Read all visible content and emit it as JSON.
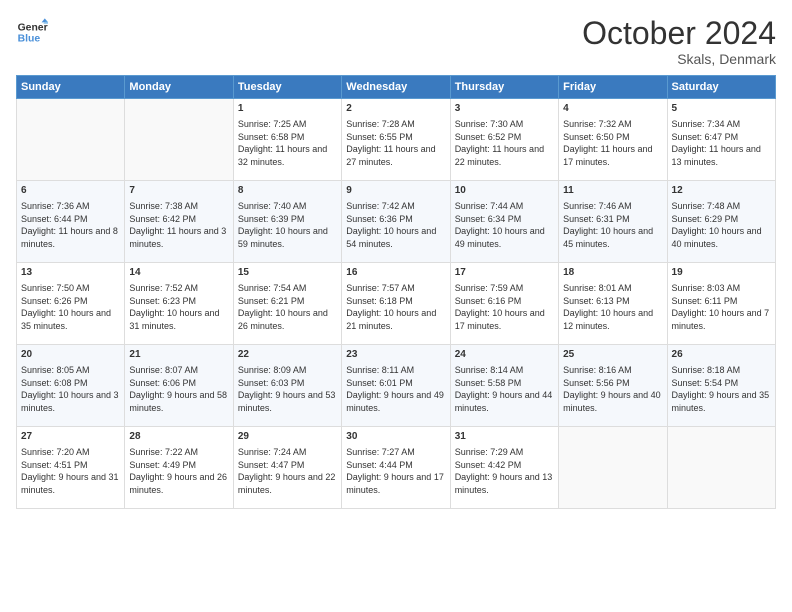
{
  "logo": {
    "line1": "General",
    "line2": "Blue"
  },
  "header": {
    "title": "October 2024",
    "subtitle": "Skals, Denmark"
  },
  "weekdays": [
    "Sunday",
    "Monday",
    "Tuesday",
    "Wednesday",
    "Thursday",
    "Friday",
    "Saturday"
  ],
  "weeks": [
    [
      {
        "day": "",
        "sunrise": "",
        "sunset": "",
        "daylight": ""
      },
      {
        "day": "",
        "sunrise": "",
        "sunset": "",
        "daylight": ""
      },
      {
        "day": "1",
        "sunrise": "Sunrise: 7:25 AM",
        "sunset": "Sunset: 6:58 PM",
        "daylight": "Daylight: 11 hours and 32 minutes."
      },
      {
        "day": "2",
        "sunrise": "Sunrise: 7:28 AM",
        "sunset": "Sunset: 6:55 PM",
        "daylight": "Daylight: 11 hours and 27 minutes."
      },
      {
        "day": "3",
        "sunrise": "Sunrise: 7:30 AM",
        "sunset": "Sunset: 6:52 PM",
        "daylight": "Daylight: 11 hours and 22 minutes."
      },
      {
        "day": "4",
        "sunrise": "Sunrise: 7:32 AM",
        "sunset": "Sunset: 6:50 PM",
        "daylight": "Daylight: 11 hours and 17 minutes."
      },
      {
        "day": "5",
        "sunrise": "Sunrise: 7:34 AM",
        "sunset": "Sunset: 6:47 PM",
        "daylight": "Daylight: 11 hours and 13 minutes."
      }
    ],
    [
      {
        "day": "6",
        "sunrise": "Sunrise: 7:36 AM",
        "sunset": "Sunset: 6:44 PM",
        "daylight": "Daylight: 11 hours and 8 minutes."
      },
      {
        "day": "7",
        "sunrise": "Sunrise: 7:38 AM",
        "sunset": "Sunset: 6:42 PM",
        "daylight": "Daylight: 11 hours and 3 minutes."
      },
      {
        "day": "8",
        "sunrise": "Sunrise: 7:40 AM",
        "sunset": "Sunset: 6:39 PM",
        "daylight": "Daylight: 10 hours and 59 minutes."
      },
      {
        "day": "9",
        "sunrise": "Sunrise: 7:42 AM",
        "sunset": "Sunset: 6:36 PM",
        "daylight": "Daylight: 10 hours and 54 minutes."
      },
      {
        "day": "10",
        "sunrise": "Sunrise: 7:44 AM",
        "sunset": "Sunset: 6:34 PM",
        "daylight": "Daylight: 10 hours and 49 minutes."
      },
      {
        "day": "11",
        "sunrise": "Sunrise: 7:46 AM",
        "sunset": "Sunset: 6:31 PM",
        "daylight": "Daylight: 10 hours and 45 minutes."
      },
      {
        "day": "12",
        "sunrise": "Sunrise: 7:48 AM",
        "sunset": "Sunset: 6:29 PM",
        "daylight": "Daylight: 10 hours and 40 minutes."
      }
    ],
    [
      {
        "day": "13",
        "sunrise": "Sunrise: 7:50 AM",
        "sunset": "Sunset: 6:26 PM",
        "daylight": "Daylight: 10 hours and 35 minutes."
      },
      {
        "day": "14",
        "sunrise": "Sunrise: 7:52 AM",
        "sunset": "Sunset: 6:23 PM",
        "daylight": "Daylight: 10 hours and 31 minutes."
      },
      {
        "day": "15",
        "sunrise": "Sunrise: 7:54 AM",
        "sunset": "Sunset: 6:21 PM",
        "daylight": "Daylight: 10 hours and 26 minutes."
      },
      {
        "day": "16",
        "sunrise": "Sunrise: 7:57 AM",
        "sunset": "Sunset: 6:18 PM",
        "daylight": "Daylight: 10 hours and 21 minutes."
      },
      {
        "day": "17",
        "sunrise": "Sunrise: 7:59 AM",
        "sunset": "Sunset: 6:16 PM",
        "daylight": "Daylight: 10 hours and 17 minutes."
      },
      {
        "day": "18",
        "sunrise": "Sunrise: 8:01 AM",
        "sunset": "Sunset: 6:13 PM",
        "daylight": "Daylight: 10 hours and 12 minutes."
      },
      {
        "day": "19",
        "sunrise": "Sunrise: 8:03 AM",
        "sunset": "Sunset: 6:11 PM",
        "daylight": "Daylight: 10 hours and 7 minutes."
      }
    ],
    [
      {
        "day": "20",
        "sunrise": "Sunrise: 8:05 AM",
        "sunset": "Sunset: 6:08 PM",
        "daylight": "Daylight: 10 hours and 3 minutes."
      },
      {
        "day": "21",
        "sunrise": "Sunrise: 8:07 AM",
        "sunset": "Sunset: 6:06 PM",
        "daylight": "Daylight: 9 hours and 58 minutes."
      },
      {
        "day": "22",
        "sunrise": "Sunrise: 8:09 AM",
        "sunset": "Sunset: 6:03 PM",
        "daylight": "Daylight: 9 hours and 53 minutes."
      },
      {
        "day": "23",
        "sunrise": "Sunrise: 8:11 AM",
        "sunset": "Sunset: 6:01 PM",
        "daylight": "Daylight: 9 hours and 49 minutes."
      },
      {
        "day": "24",
        "sunrise": "Sunrise: 8:14 AM",
        "sunset": "Sunset: 5:58 PM",
        "daylight": "Daylight: 9 hours and 44 minutes."
      },
      {
        "day": "25",
        "sunrise": "Sunrise: 8:16 AM",
        "sunset": "Sunset: 5:56 PM",
        "daylight": "Daylight: 9 hours and 40 minutes."
      },
      {
        "day": "26",
        "sunrise": "Sunrise: 8:18 AM",
        "sunset": "Sunset: 5:54 PM",
        "daylight": "Daylight: 9 hours and 35 minutes."
      }
    ],
    [
      {
        "day": "27",
        "sunrise": "Sunrise: 7:20 AM",
        "sunset": "Sunset: 4:51 PM",
        "daylight": "Daylight: 9 hours and 31 minutes."
      },
      {
        "day": "28",
        "sunrise": "Sunrise: 7:22 AM",
        "sunset": "Sunset: 4:49 PM",
        "daylight": "Daylight: 9 hours and 26 minutes."
      },
      {
        "day": "29",
        "sunrise": "Sunrise: 7:24 AM",
        "sunset": "Sunset: 4:47 PM",
        "daylight": "Daylight: 9 hours and 22 minutes."
      },
      {
        "day": "30",
        "sunrise": "Sunrise: 7:27 AM",
        "sunset": "Sunset: 4:44 PM",
        "daylight": "Daylight: 9 hours and 17 minutes."
      },
      {
        "day": "31",
        "sunrise": "Sunrise: 7:29 AM",
        "sunset": "Sunset: 4:42 PM",
        "daylight": "Daylight: 9 hours and 13 minutes."
      },
      {
        "day": "",
        "sunrise": "",
        "sunset": "",
        "daylight": ""
      },
      {
        "day": "",
        "sunrise": "",
        "sunset": "",
        "daylight": ""
      }
    ]
  ]
}
